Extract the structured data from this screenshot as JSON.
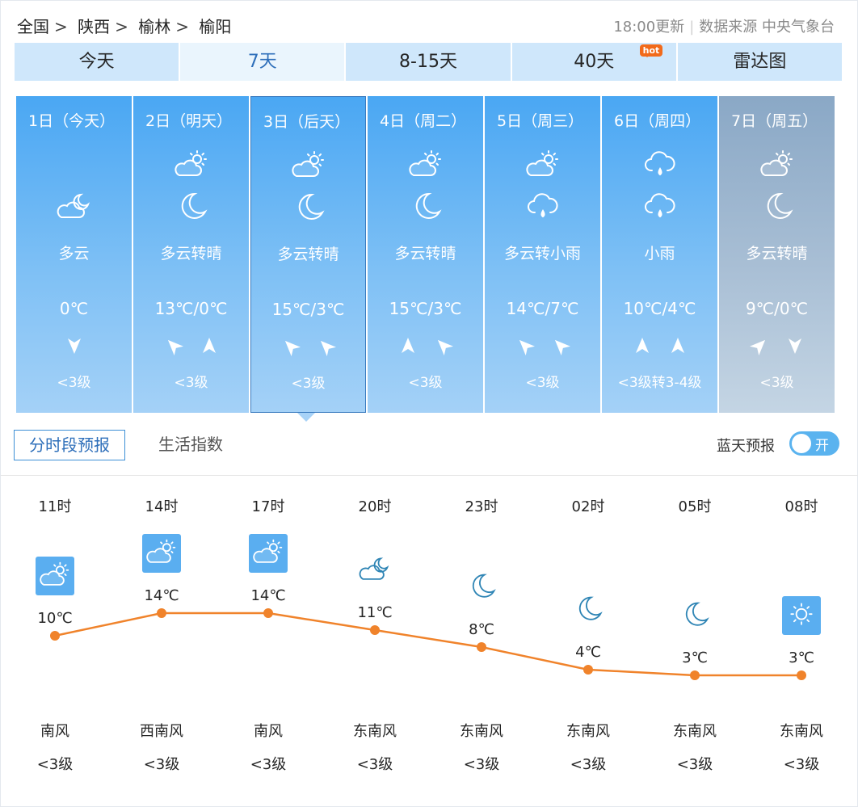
{
  "breadcrumb": [
    "全国",
    "陕西",
    "榆林",
    "榆阳"
  ],
  "update": {
    "time": "18:00更新",
    "source": "数据来源 中央气象台"
  },
  "tabs": [
    "今天",
    "7天",
    "8-15天",
    "40天",
    "雷达图"
  ],
  "hot_badge": "hot",
  "days": [
    {
      "date": "1日（今天）",
      "desc": "多云",
      "temp": "0℃",
      "wind_level": "<3级",
      "icons": [
        "night-cloudy-icon"
      ],
      "winds": [
        "south-wind-arrow-icon"
      ]
    },
    {
      "date": "2日（明天）",
      "desc": "多云转晴",
      "temp": "13℃/0℃",
      "wind_level": "<3级",
      "icons": [
        "partly-cloudy-icon",
        "moon-icon"
      ],
      "winds": [
        "northwest-wind-arrow-icon",
        "north-wind-arrow-icon"
      ]
    },
    {
      "date": "3日（后天）",
      "desc": "多云转晴",
      "temp": "15℃/3℃",
      "wind_level": "<3级",
      "icons": [
        "partly-cloudy-icon",
        "moon-icon"
      ],
      "winds": [
        "northwest-wind-arrow-icon",
        "northwest-wind-arrow-icon"
      ]
    },
    {
      "date": "4日（周二）",
      "desc": "多云转晴",
      "temp": "15℃/3℃",
      "wind_level": "<3级",
      "icons": [
        "partly-cloudy-icon",
        "moon-icon"
      ],
      "winds": [
        "north-wind-arrow-icon",
        "northwest-wind-arrow-icon"
      ]
    },
    {
      "date": "5日（周三）",
      "desc": "多云转小雨",
      "temp": "14℃/7℃",
      "wind_level": "<3级",
      "icons": [
        "partly-cloudy-icon",
        "light-rain-icon"
      ],
      "winds": [
        "northwest-wind-arrow-icon",
        "northwest-wind-arrow-icon"
      ]
    },
    {
      "date": "6日（周四）",
      "desc": "小雨",
      "temp": "10℃/4℃",
      "wind_level": "<3级转3-4级",
      "icons": [
        "light-rain-icon",
        "light-rain-icon"
      ],
      "winds": [
        "north-wind-arrow-icon",
        "north-wind-arrow-icon"
      ]
    },
    {
      "date": "7日（周五）",
      "desc": "多云转晴",
      "temp": "9℃/0℃",
      "wind_level": "<3级",
      "icons": [
        "partly-cloudy-icon",
        "moon-icon"
      ],
      "winds": [
        "northeast-wind-arrow-icon",
        "south-wind-arrow-icon"
      ]
    }
  ],
  "subtabs": [
    "分时段预报",
    "生活指数"
  ],
  "bluesky": {
    "label": "蓝天预报",
    "toggle": "开"
  },
  "hourly": {
    "times": [
      "11时",
      "14时",
      "17时",
      "20时",
      "23时",
      "02时",
      "05时",
      "08时"
    ],
    "temps": [
      10,
      14,
      14,
      11,
      8,
      4,
      3,
      3
    ],
    "temp_labels": [
      "10℃",
      "14℃",
      "14℃",
      "11℃",
      "8℃",
      "4℃",
      "3℃",
      "3℃"
    ],
    "icons": [
      "partly-cloudy-icon",
      "partly-cloudy-icon",
      "partly-cloudy-icon",
      "night-cloudy-icon",
      "moon-icon",
      "moon-icon",
      "moon-icon",
      "sunny-icon"
    ],
    "wind_dirs": [
      "南风",
      "西南风",
      "南风",
      "东南风",
      "东南风",
      "东南风",
      "东南风",
      "东南风"
    ],
    "wind_levels": [
      "<3级",
      "<3级",
      "<3级",
      "<3级",
      "<3级",
      "<3级",
      "<3级",
      "<3级"
    ]
  },
  "colors": {
    "accent": "#2e6fba",
    "line": "#f0832b",
    "tab_bg": "#cfe7fb",
    "card_top": "#4aa7f3",
    "card_bottom": "#a4d1f7",
    "icon_box": "#5aaef0",
    "dark_icon": "#2f85b5"
  }
}
